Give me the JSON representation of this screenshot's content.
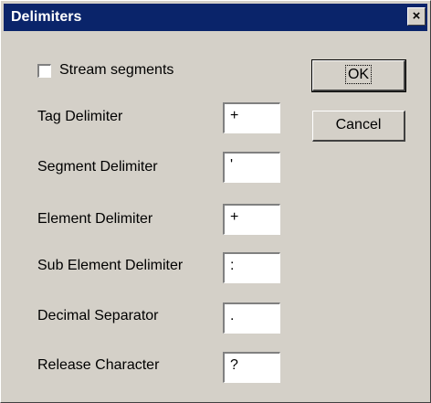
{
  "window": {
    "title": "Delimiters",
    "close_label": "×"
  },
  "stream_segments": {
    "label": "Stream segments",
    "checked": false
  },
  "fields": [
    {
      "label": "Tag Delimiter",
      "value": "+"
    },
    {
      "label": "Segment Delimiter",
      "value": "'"
    },
    {
      "label": "Element Delimiter",
      "value": "+"
    },
    {
      "label": "Sub Element Delimiter",
      "value": ":"
    },
    {
      "label": "Decimal Separator",
      "value": "."
    },
    {
      "label": "Release Character",
      "value": "?"
    }
  ],
  "buttons": {
    "ok_label": "OK",
    "cancel_label": "Cancel"
  }
}
